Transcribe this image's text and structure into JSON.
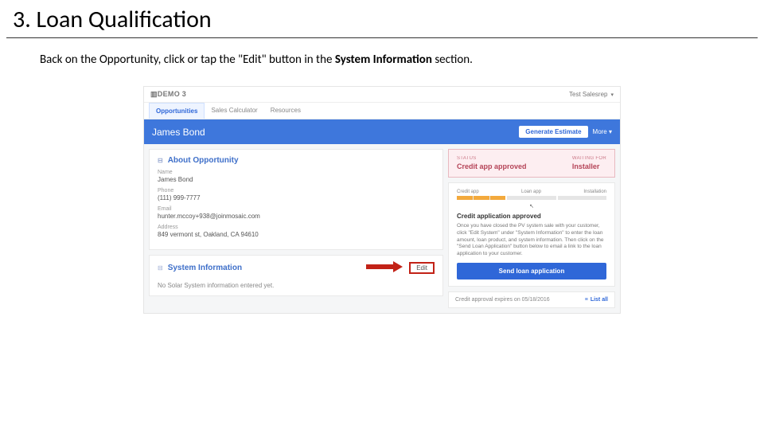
{
  "doc": {
    "title": "3. Loan Qualification",
    "body_pre": "Back on the Opportunity, click or tap the \"Edit\" button in the ",
    "body_strong": "System Information",
    "body_post": " section."
  },
  "shot": {
    "logo": "▥DEMO 3",
    "user": "Test Salesrep",
    "tabs": {
      "opportunities": "Opportunities",
      "calc": "Sales Calculator",
      "resources": "Resources"
    },
    "hero": {
      "name": "James Bond",
      "estimate": "Generate Estimate",
      "more": "More ▾"
    },
    "about": {
      "title": "About Opportunity",
      "name_label": "Name",
      "name_val": "James Bond",
      "phone_label": "Phone",
      "phone_val": "(111) 999-7777",
      "email_label": "Email",
      "email_val": "hunter.mccoy+938@joinmosaic.com",
      "addr_label": "Address",
      "addr_val": "849 vermont st, Oakland, CA 94610"
    },
    "sysinfo": {
      "title": "System Information",
      "edit": "Edit",
      "empty": "No Solar System information entered yet."
    },
    "status": {
      "status_label": "STATUS",
      "status_val": "Credit app approved",
      "wait_label": "WAITING FOR",
      "wait_val": "Installer"
    },
    "progress": {
      "labels": {
        "a": "Credit app",
        "b": "Loan app",
        "c": "Installation"
      },
      "title": "Credit application approved",
      "body": "Once you have closed the PV system sale with your customer, click \"Edit System\" under \"System Information\" to enter the loan amount, loan product, and system information. Then click on the \"Send Loan Application\" button below to email a link to the loan application to your customer.",
      "send": "Send loan application"
    },
    "footer": {
      "expires": "Credit approval expires on 05/18/2016",
      "listall": "List all"
    }
  }
}
